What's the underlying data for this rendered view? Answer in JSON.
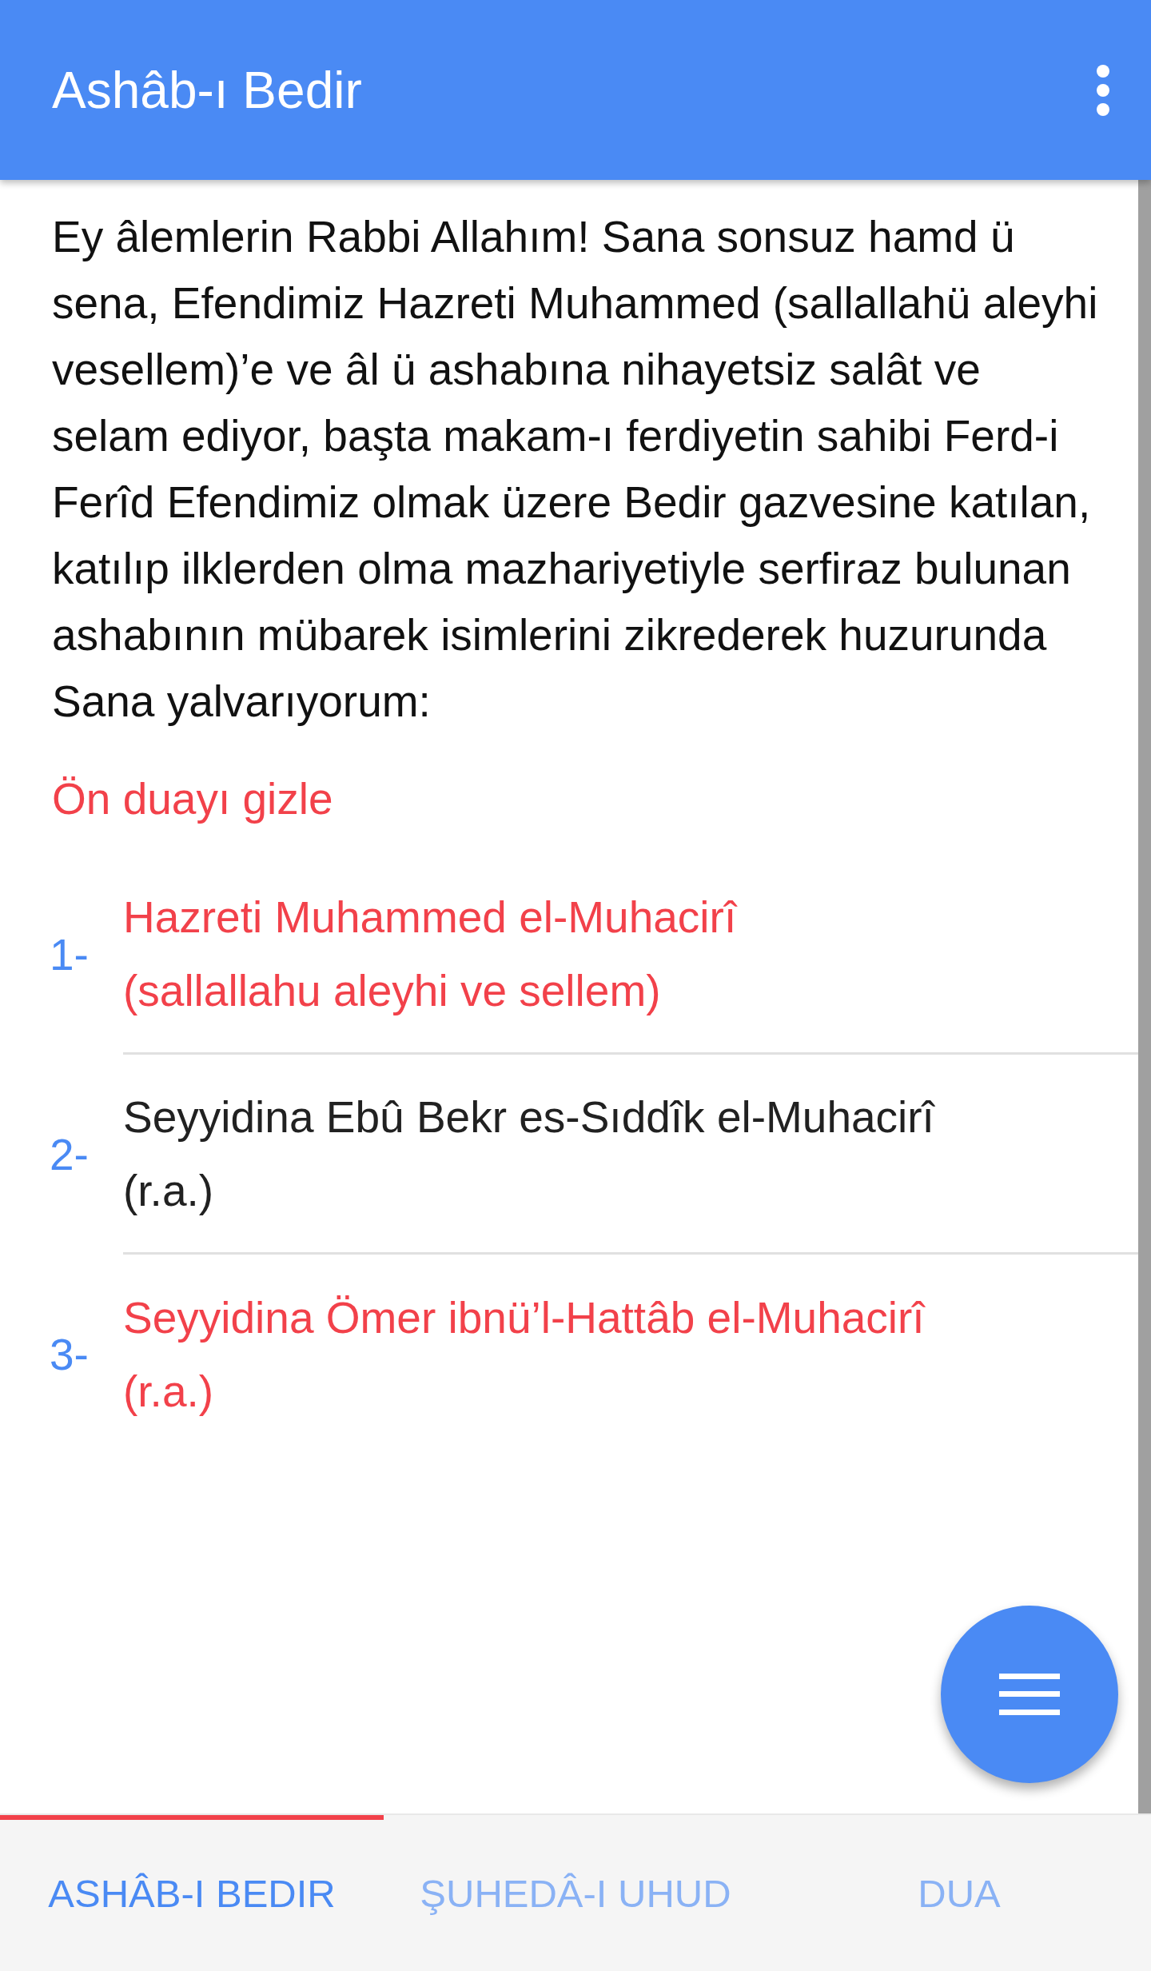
{
  "app_bar": {
    "title": "Ashâb-ı Bedir"
  },
  "intro": {
    "text": "Ey âlemlerin Rabbi Allahım! Sana sonsuz hamd ü sena, Efendimiz Hazreti Muhammed (sallallahü aleyhi vesellem)’e ve âl ü ashabına nihayetsiz salât ve selam ediyor, başta makam-ı ferdiyetin sahibi Ferd-i Ferîd Efendimiz olmak üzere Bedir gazvesine katılan, katılıp ilklerden olma mazhariyetiyle serfiraz bulunan ashabının mübarek isimlerini zikrederek huzurunda Sana yalvarıyorum:",
    "toggle": "Ön duayı gizle"
  },
  "items": [
    {
      "number": "1-",
      "name": "Hazreti Muhammed el-Muhacirî (sallallahu aleyhi ve sellem)",
      "color": "#f2414a"
    },
    {
      "number": "2-",
      "name": "Seyyidina Ebû Bekr es-Sıddîk el-Muhacirî (r.a.)",
      "color": "#212121"
    },
    {
      "number": "3-",
      "name": "Seyyidina Ömer ibnü’l-Hattâb el-Muhacirî (r.a.)",
      "color": "#f2414a"
    }
  ],
  "tabs": [
    {
      "label": "ASHÂB-I BEDIR",
      "selected": true
    },
    {
      "label": "ŞUHEDÂ-I UHUD",
      "selected": false
    },
    {
      "label": "DUA",
      "selected": false
    }
  ]
}
